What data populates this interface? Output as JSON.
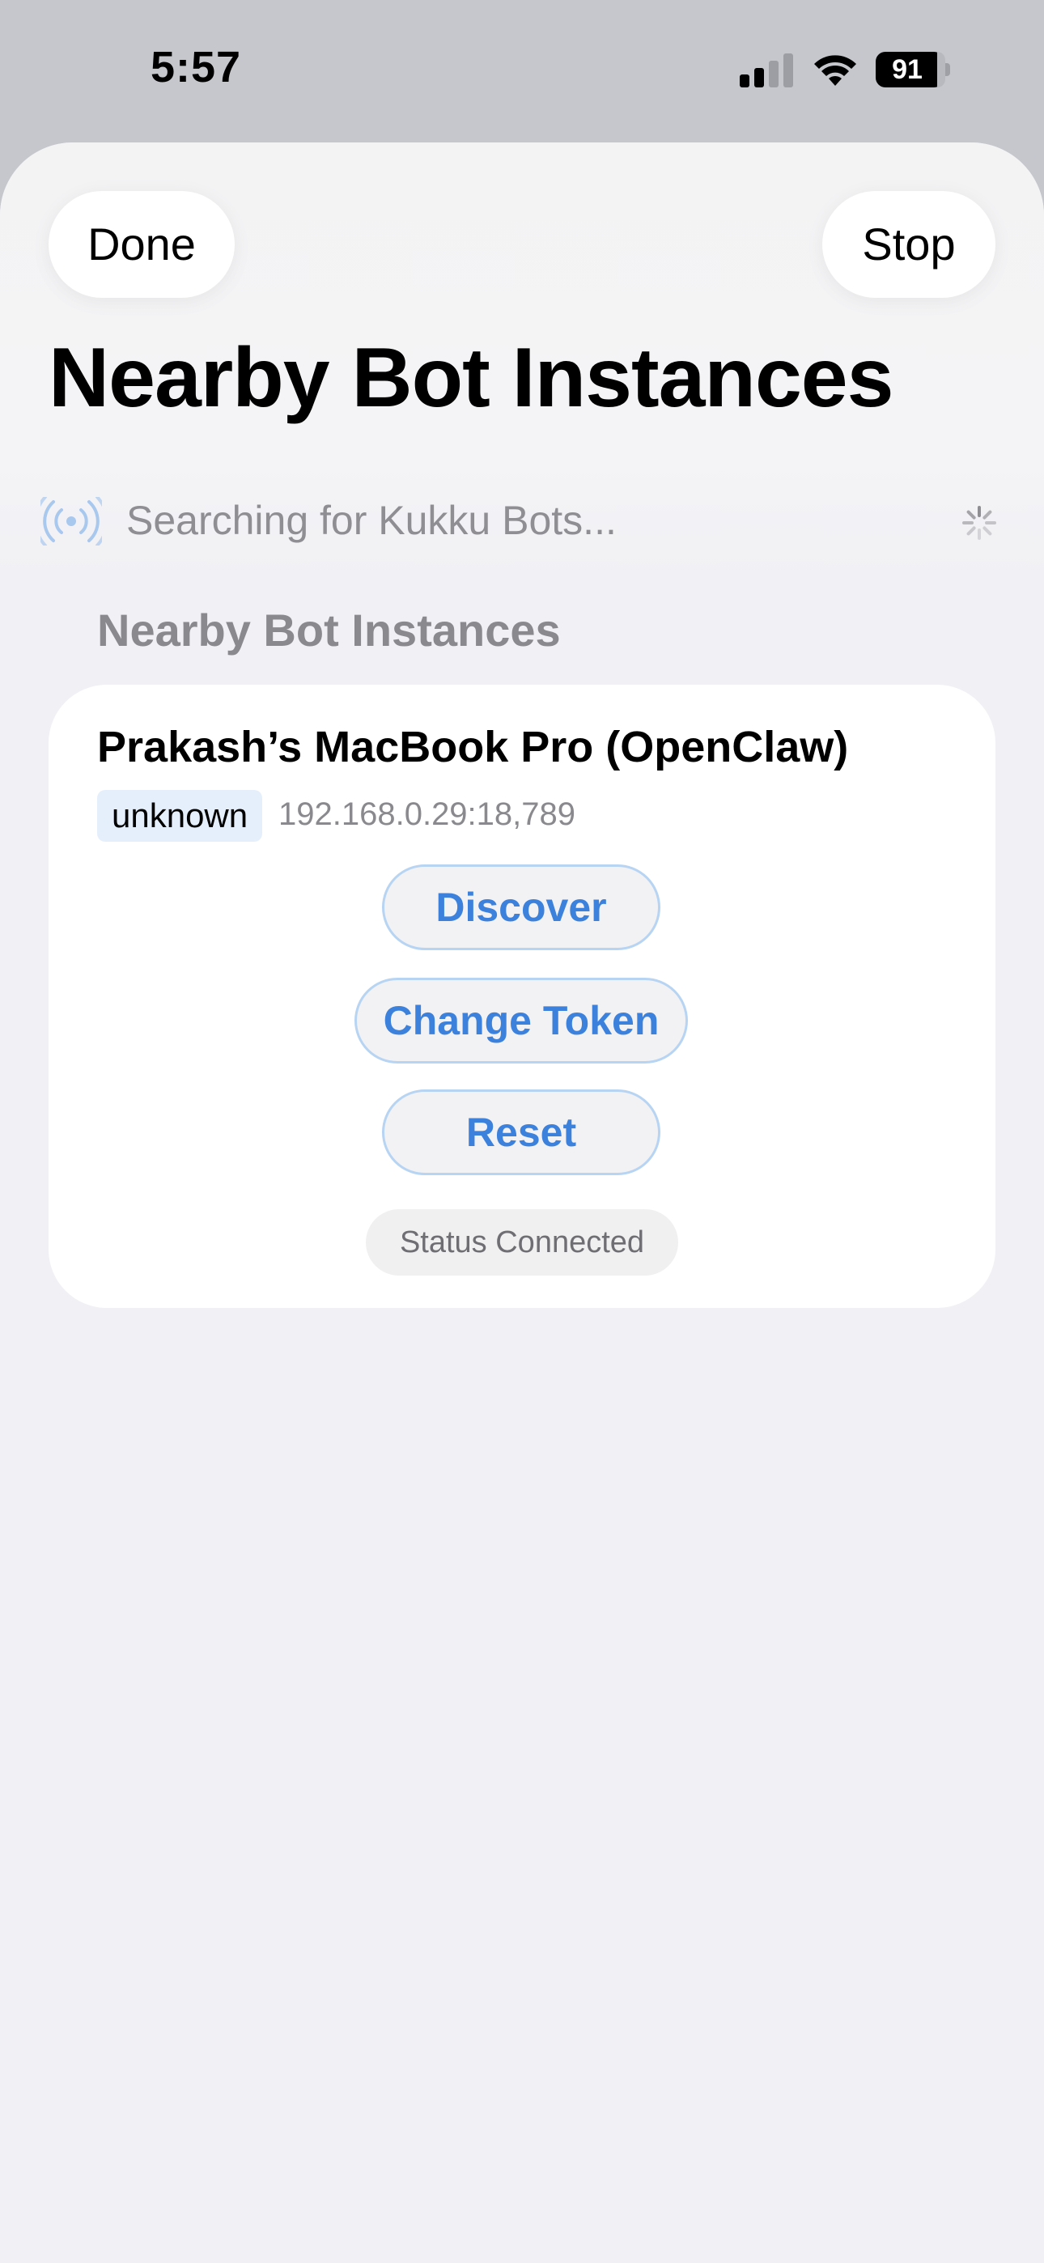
{
  "status_bar": {
    "time": "5:57",
    "battery_level": "91",
    "signal_bars_active": 2,
    "signal_bars_total": 4
  },
  "header": {
    "done_label": "Done",
    "stop_label": "Stop",
    "title": "Nearby Bot Instances"
  },
  "search": {
    "status_text": "Searching for Kukku Bots..."
  },
  "section": {
    "title": "Nearby Bot Instances"
  },
  "device": {
    "name": "Prakash’s MacBook Pro (OpenClaw)",
    "tag": "unknown",
    "address": "192.168.0.29:18,789",
    "discover_label": "Discover",
    "change_token_label": "Change Token",
    "reset_label": "Reset",
    "status": "Status Connected"
  },
  "colors": {
    "accent": "#3c82dc",
    "button_border": "#b7d4f3",
    "tag_background": "#e5effc",
    "secondary_text": "#8e8e93",
    "broadcast_icon": "#a9c8ee"
  },
  "icons": {
    "signal": "cellular-signal-icon",
    "wifi": "wifi-icon",
    "battery": "battery-icon",
    "broadcast": "broadcast-antenna-icon",
    "spinner": "activity-spinner-icon"
  }
}
